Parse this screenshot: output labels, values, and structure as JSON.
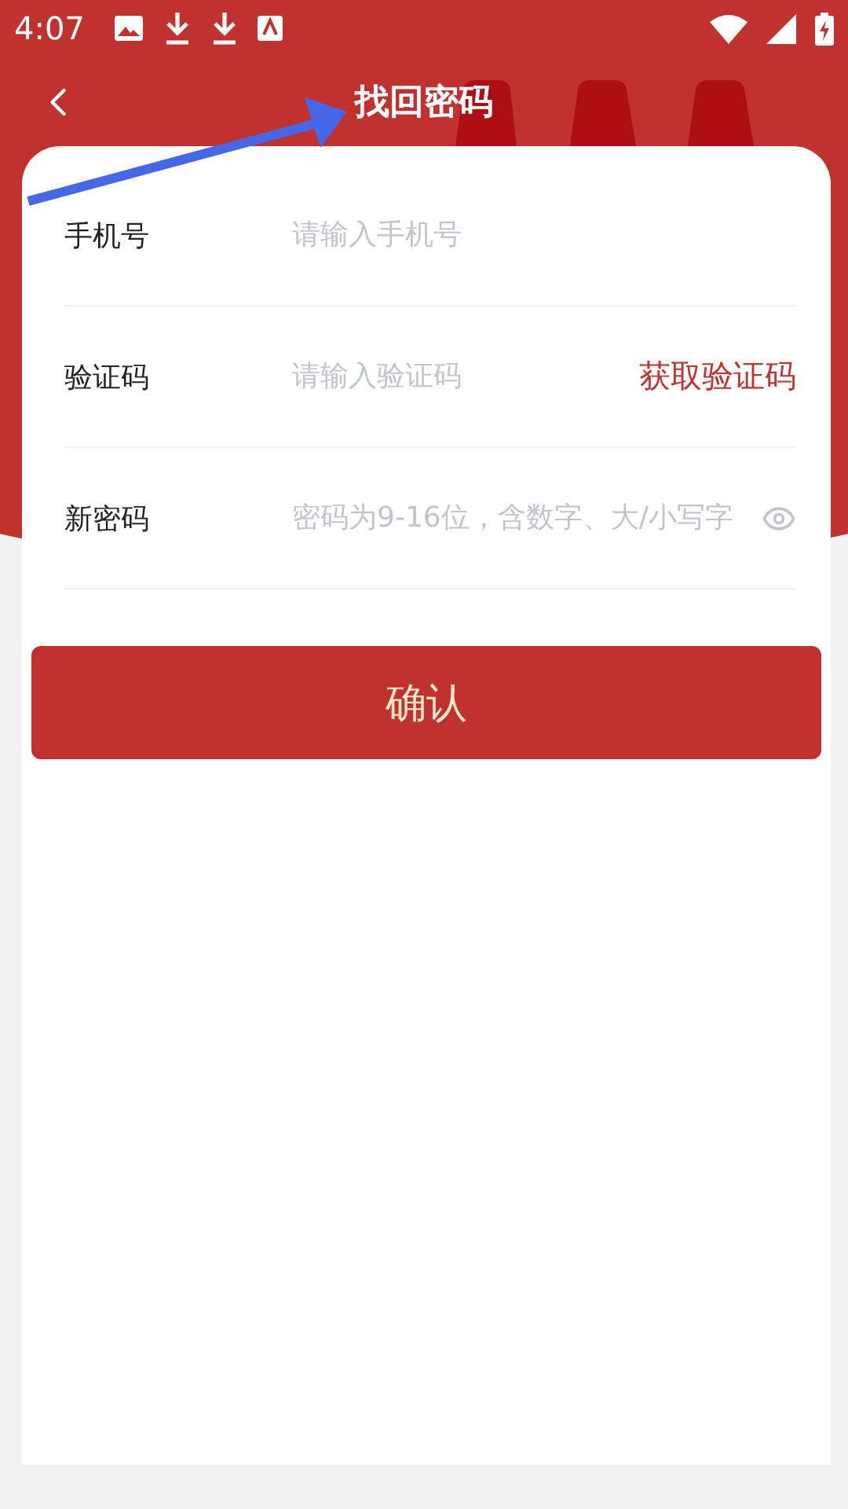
{
  "status_bar": {
    "time": "4:07"
  },
  "header": {
    "title": "找回密码"
  },
  "form": {
    "fields": [
      {
        "kind": "phone",
        "label": "手机号",
        "placeholder": "请输入手机号"
      },
      {
        "kind": "code",
        "label": "验证码",
        "placeholder": "请输入验证码",
        "action": "获取验证码"
      },
      {
        "kind": "password",
        "label": "新密码",
        "placeholder": "密码为9-16位，含数字、大/小写字"
      }
    ]
  },
  "submit_button": "确认"
}
